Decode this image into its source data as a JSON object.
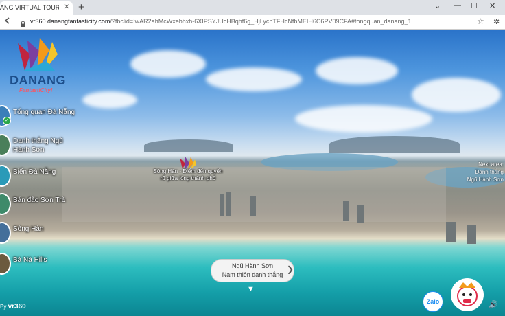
{
  "browser": {
    "tab_title": "ANG VIRTUAL TOURIST BY",
    "tab_close": "✕",
    "new_tab": "+",
    "window_controls": {
      "collapse": "⌄",
      "minimize": "—",
      "maximize": "☐",
      "close": "✕"
    },
    "url_host": "vr360.danangfantasticity.com",
    "url_rest": "/?fbclid=IwAR2ahMcWxebhxh-6XIPSYJUcHBqhf6g_HjLychTFHcNfbMEIH6C6PV09CFA#tongquan_danang_1",
    "icons": {
      "back": "arrow-left-icon",
      "forward": "arrow-right-icon",
      "reload": "reload-icon",
      "lock": "lock-icon",
      "bookmark": "star-icon",
      "extensions": "puzzle-icon"
    }
  },
  "logo": {
    "name": "DANANG",
    "tagline": "FantastiCity!"
  },
  "sidebar": {
    "items": [
      {
        "label": "Tổng quan Đà Nẵng"
      },
      {
        "label": "Danh thắng Ngũ Hành Sơn"
      },
      {
        "label": "Biển Đà Nẵng"
      },
      {
        "label": "Bán đảo Sơn Trà"
      },
      {
        "label": "Sông Hàn"
      },
      {
        "label": "Bà Nà Hills"
      }
    ]
  },
  "hotspot": {
    "label": "Sông Hàn - Điểm đến quyến rũ giữa lòng thành phố"
  },
  "next_area": {
    "line1": "Next area:",
    "line2": "Danh thắng",
    "line3": "Ngũ Hành Sơn"
  },
  "center_nav": {
    "line1": "Ngũ Hành Sơn",
    "line2": "Nam thiên danh thắng",
    "arrow": "❯",
    "down": "▼"
  },
  "footer": {
    "powered_prefix": "By",
    "powered_brand": "vr360"
  },
  "widgets": {
    "zalo": "Zalo",
    "sound": "🔊"
  },
  "colors": {
    "brand_blue": "#1d4f8c",
    "accent_pink": "#f25a6a",
    "zalo_blue": "#1f8ef1",
    "check_green": "#2aa84a"
  }
}
